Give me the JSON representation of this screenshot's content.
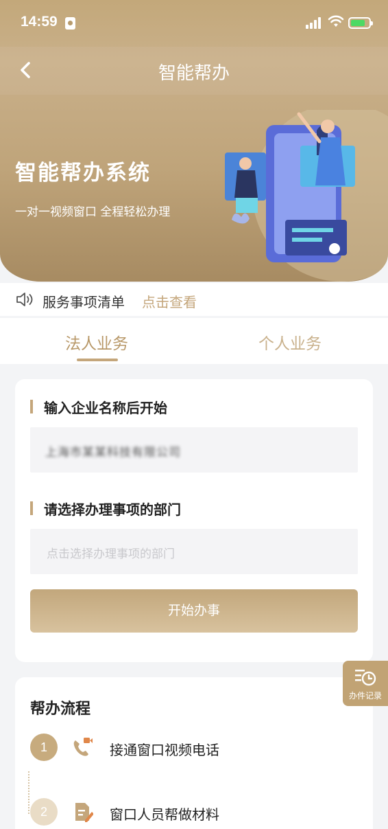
{
  "status_bar": {
    "time": "14:59"
  },
  "nav": {
    "title": "智能帮办"
  },
  "banner": {
    "title": "智能帮办系统",
    "subtitle": "一对一视频窗口 全程轻松办理"
  },
  "notice": {
    "text": "服务事项清单",
    "link": "点击查看"
  },
  "tabs": [
    {
      "label": "法人业务",
      "active": true
    },
    {
      "label": "个人业务",
      "active": false
    }
  ],
  "form": {
    "company_label": "输入企业名称后开始",
    "company_value": "上海市某某科技有限公司",
    "department_label": "请选择办理事项的部门",
    "department_placeholder": "点击选择办理事项的部门",
    "start_button": "开始办事"
  },
  "floating": {
    "record_label": "办件记录"
  },
  "process": {
    "title": "帮办流程",
    "steps": [
      {
        "number": "1",
        "label": "接通窗口视频电话",
        "icon": "video-call-icon"
      },
      {
        "number": "2",
        "label": "窗口人员帮做材料",
        "icon": "document-edit-icon"
      }
    ]
  },
  "colors": {
    "accent": "#c4a67b",
    "header": "#c3a87a",
    "page_bg": "#f3f4f6"
  }
}
